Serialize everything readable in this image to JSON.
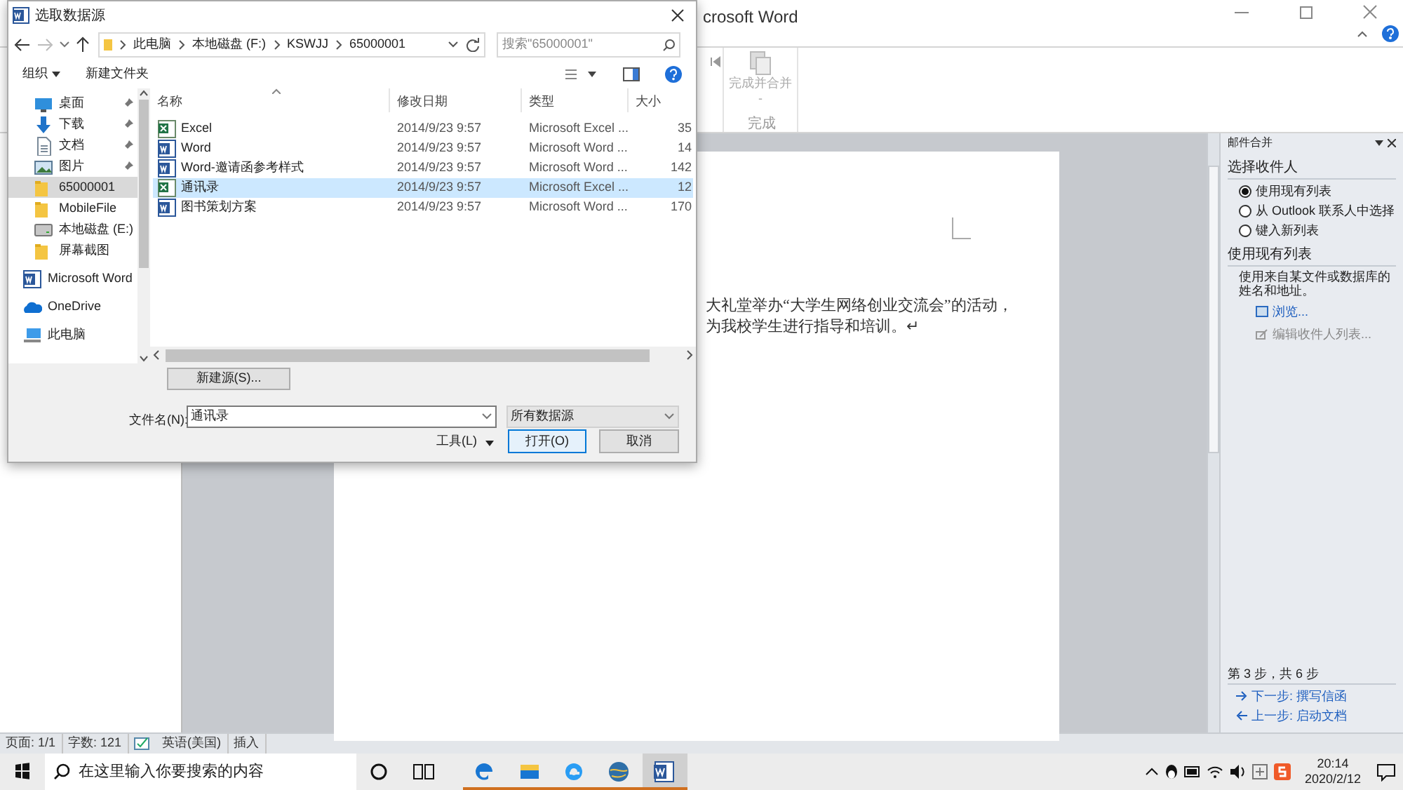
{
  "word": {
    "title": "crosoft Word",
    "ribbon": {
      "button": "完成并合并",
      "button_caret": "-",
      "group": "完成"
    },
    "document": [
      "大礼堂举办“大学生网络创业交流会”的活动，",
      "为我校学生进行指导和培训。↵"
    ],
    "mail_merge": {
      "title": "邮件合并",
      "section1": "选择收件人",
      "options": [
        {
          "label": "使用现有列表",
          "selected": true
        },
        {
          "label": "从 Outlook 联系人中选择",
          "selected": false
        },
        {
          "label": "键入新列表",
          "selected": false
        }
      ],
      "section2": "使用现有列表",
      "description": "使用来自某文件或数据库的姓名和地址。",
      "links": [
        {
          "label": "浏览...",
          "kind": "browse",
          "disabled": false
        },
        {
          "label": "编辑收件人列表...",
          "kind": "edit",
          "disabled": true
        }
      ],
      "step": "第 3 步，共 6 步",
      "nav_links": [
        {
          "label": "下一步: 撰写信函",
          "kind": "next"
        },
        {
          "label": "上一步: 启动文档",
          "kind": "prev"
        }
      ]
    },
    "status_bar": [
      "页面: 1/1",
      "字数: 121",
      "英语(美国)",
      "插入"
    ]
  },
  "dialog": {
    "title": "选取数据源",
    "breadcrumb": [
      "此电脑",
      "本地磁盘 (F:)",
      "KSWJJ",
      "65000001"
    ],
    "search_placeholder": "搜索\"65000001\"",
    "toolbar": [
      "组织",
      "新建文件夹"
    ],
    "nav": [
      {
        "label": "桌面",
        "kind": "desktop",
        "pinned": true,
        "selected": false
      },
      {
        "label": "下载",
        "kind": "download",
        "pinned": true,
        "selected": false
      },
      {
        "label": "文档",
        "kind": "document",
        "pinned": true,
        "selected": false
      },
      {
        "label": "图片",
        "kind": "picture",
        "pinned": true,
        "selected": false
      },
      {
        "label": "65000001",
        "kind": "folder",
        "pinned": false,
        "selected": true
      },
      {
        "label": "MobileFile",
        "kind": "folder",
        "pinned": false,
        "selected": false
      },
      {
        "label": "本地磁盘 (E:)",
        "kind": "drive",
        "pinned": false,
        "selected": false
      },
      {
        "label": "屏幕截图",
        "kind": "folder",
        "pinned": false,
        "selected": false
      },
      {
        "label": "Microsoft Word",
        "kind": "word",
        "pinned": false,
        "selected": false
      },
      {
        "label": "OneDrive",
        "kind": "onedrive",
        "pinned": false,
        "selected": false
      },
      {
        "label": "此电脑",
        "kind": "pc",
        "pinned": false,
        "selected": false
      }
    ],
    "columns": [
      "名称",
      "修改日期",
      "类型",
      "大小"
    ],
    "files": [
      {
        "name": "Excel",
        "kind": "excel",
        "date": "2014/9/23 9:57",
        "type": "Microsoft Excel ...",
        "size": "35",
        "selected": false
      },
      {
        "name": "Word",
        "kind": "word",
        "date": "2014/9/23 9:57",
        "type": "Microsoft Word ...",
        "size": "14",
        "selected": false
      },
      {
        "name": "Word-邀请函参考样式",
        "kind": "word",
        "date": "2014/9/23 9:57",
        "type": "Microsoft Word ...",
        "size": "142",
        "selected": false
      },
      {
        "name": "通讯录",
        "kind": "excel",
        "date": "2014/9/23 9:57",
        "type": "Microsoft Excel ...",
        "size": "12",
        "selected": true
      },
      {
        "name": "图书策划方案",
        "kind": "word",
        "date": "2014/9/23 9:57",
        "type": "Microsoft Word ...",
        "size": "170",
        "selected": false
      }
    ],
    "new_source_button": "新建源(S)...",
    "filename_label": "文件名(N):",
    "filename": "通讯录",
    "filetype": "所有数据源",
    "tools": "工具(L)",
    "open_button": "打开(O)",
    "cancel_button": "取消"
  },
  "taskbar": {
    "search_placeholder": "在这里输入你要搜索的内容",
    "apps": [
      {
        "kind": "edge",
        "active": false
      },
      {
        "kind": "explorer",
        "active": false
      },
      {
        "kind": "ie",
        "active": false
      },
      {
        "kind": "globe",
        "active": false
      },
      {
        "kind": "word",
        "active": true
      }
    ],
    "time": "20:14",
    "date": "2020/2/12"
  }
}
